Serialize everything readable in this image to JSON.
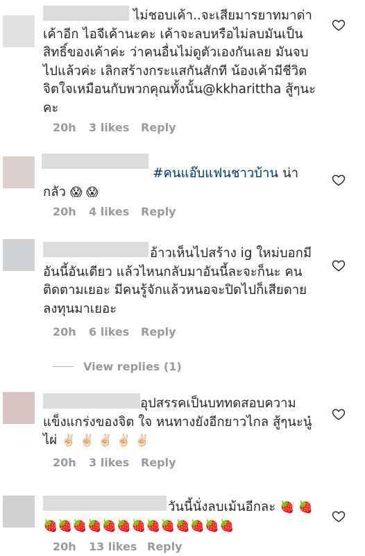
{
  "comments": [
    {
      "text": "ไม่ชอบเค้า..จะเสียมารยาทมาด่าเค้าอีก ไอจีเค้านะคะ เค้าจะลบหรือไม่ลบมันเป็นสิทธิ์ของเค้าค่ะ ว่าคนอื่นไม่ดูตัวเองกันเลย มันจบไปแล้วค่ะ เลิกสร้างกระแสกันสักที น้องเค้ามีชีวิตจิตใจเหมือนกับพวกคุณทั้งนั้น@kkharittha สู้ๆนะคะ",
      "time": "20h",
      "likes": "3 likes",
      "reply": "Reply"
    },
    {
      "hashtag": "#คนแอ๊บแฟนชาวบ้าน",
      "text_after": " น่ากลัว",
      "emoji": "😱 😱",
      "time": "20h",
      "likes": "4 likes",
      "reply": "Reply"
    },
    {
      "text": "อ้าวเห็นไปสร้าง ig ใหม่บอกมีอันนี้อันเดียว แล้วไหนกลับมาอันนี้ละจะก็นะ คนติดตามเยอะ มีคนรู้จักแล้วหนอจะปิดไปก็เสียดาย ลงทุนมาเยอะ",
      "time": "20h",
      "likes": "6 likes",
      "reply": "Reply",
      "view_replies": "View replies (1)"
    },
    {
      "text": "อุปสรรคเป็นบททดสอบความแข็งแกร่งของจิต ใจ หนทางยังอีกยาวไกล สู้ๆนะนู๋ไผ่",
      "emoji": "✌🏻 ✌🏻 ✌🏻 ✌🏻 ✌🏻",
      "time": "20h",
      "likes": "3 likes",
      "reply": "Reply"
    },
    {
      "text": "วันนี้นั่งลบเม้นอีกละ",
      "emoji": "🍓 🍓🍓🍓🍓🍓🍓🍓🍓🍓🍓🍓🍓🍓🍓",
      "time": "20h",
      "likes": "13 likes",
      "reply": "Reply"
    }
  ],
  "colors": {
    "text": "#262626",
    "meta": "#9a9a9a",
    "hashtag": "#003569"
  },
  "icons": [
    "heart-icon"
  ]
}
